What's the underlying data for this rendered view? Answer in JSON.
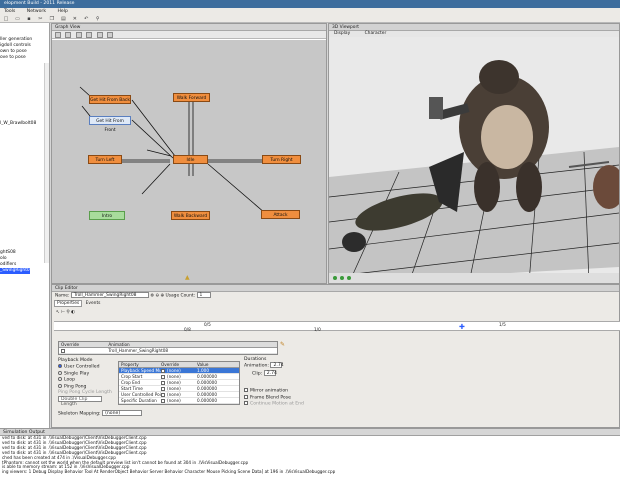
{
  "window": {
    "title": "elopment Build - 2011 Release"
  },
  "menu": [
    "Tools",
    "Network",
    "Help"
  ],
  "left_panel": {
    "items": [
      "ller generation",
      "igdoll controls",
      "own to pose",
      "ove to pose",
      "l_W_Brawlbolt08",
      "ghtS08",
      "olo",
      "odifiers",
      "_SwingRight08"
    ],
    "selected_index": 8
  },
  "graph_view": {
    "title": "Graph View",
    "nodes": {
      "hit_back": "Get Hit From Back",
      "hit_front": "Get Hit From Front",
      "walk_forward": "Walk Forward",
      "turn_left": "Turn Left",
      "idle": "Idle",
      "turn_right": "Turn Right",
      "intro": "Intro",
      "walk_backward": "Walk Backward",
      "attack": "Attack"
    }
  },
  "viewport": {
    "title": "3D Viewport",
    "tabs": [
      "Display",
      "Character"
    ]
  },
  "clip_editor": {
    "title": "Clip Editor",
    "name_label": "Name:",
    "name_value": "Troll_Hammer_SwingRight08",
    "usage_label": "Usage Count:",
    "usage_value": "1",
    "tabs": [
      "Properties",
      "Events"
    ],
    "ruler_ticks": [
      "0/5",
      "0/8",
      "1/0",
      "1/5"
    ],
    "animation_label": "Animation",
    "animation_value": "Troll_Hammer_SwingRight08",
    "override_label": "Override",
    "playback_mode_label": "Playback Mode",
    "playback_options": [
      "User Controlled",
      "Single Play",
      "Loop",
      "Ping Pong"
    ],
    "pingpong_length_label": "Ping Pong Cycle Length",
    "pingpong_length_value": "Double Clip Length",
    "props_headers": [
      "Property",
      "Override",
      "Value"
    ],
    "props": [
      {
        "name": "Playback Speed Multiplier",
        "override": "(none)",
        "value": "1.000"
      },
      {
        "name": "Crop Start",
        "override": "(none)",
        "value": "0.000000"
      },
      {
        "name": "Crop End",
        "override": "(none)",
        "value": "0.000000"
      },
      {
        "name": "Start Time",
        "override": "(none)",
        "value": "0.000000"
      },
      {
        "name": "User Controlled Point",
        "override": "(none)",
        "value": "0.000000"
      },
      {
        "name": "Specific Duration",
        "override": "(none)",
        "value": "0.000000"
      }
    ],
    "durations_label": "Durations",
    "animation_duration_label": "Animation:",
    "animation_duration_value": "2.74",
    "clip_duration_label": "Clip:",
    "clip_duration_value": "2.74",
    "checks": [
      "Mirror animation",
      "Frame Blend Pose",
      "Continue Motion at End"
    ],
    "skeleton_label": "Skeleton Mapping:",
    "skeleton_value": "(none)"
  },
  "output": {
    "title": "Simulation Output",
    "lines": [
      "ved to disk: at 431 in .\\VisualDebugger\\Client\\VisDebuggerClient.cpp",
      "ved to disk: at 431 in .\\VisualDebugger\\Client\\VisDebuggerClient.cpp",
      "ved to disk: at 431 in .\\VisualDebugger\\Client\\VisDebuggerClient.cpp",
      "ved to disk: at 431 in .\\VisualDebugger\\Client\\VisDebuggerClient.cpp",
      "ched has been created at 474 in .\\VisualDebugger.cpp",
      "tPhantom: cannot set the world when the default preview list isn't cannot be found at 304 in .\\VisVisualDebugger.cpp",
      "is able to memory stream: at 152 in .\\VisVisualDebugger.cpp",
      "ing viewers: 1 Debug Display Behavior Tool At RenderObject Behavior Server Behavior Character Mouse Picking Scene Data] at 196 in .\\VisVisualDebugger.cpp"
    ]
  },
  "colors": {
    "accent": "#2b5cff",
    "node_orange": "#f08e3e",
    "node_blue": "#dfe9f7",
    "node_green": "#a8dc9c"
  }
}
